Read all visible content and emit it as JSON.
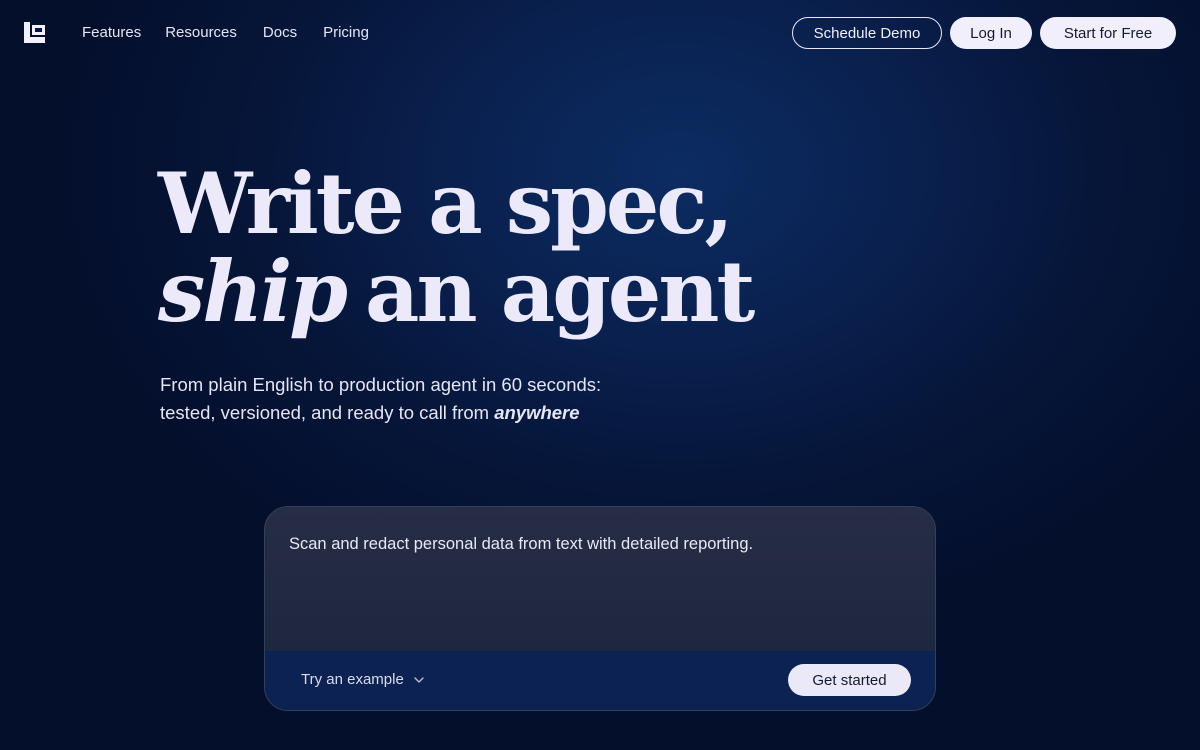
{
  "nav": {
    "links": [
      "Features",
      "Resources",
      "Docs",
      "Pricing"
    ],
    "schedule_demo": "Schedule Demo",
    "log_in": "Log In",
    "start_free": "Start for Free"
  },
  "hero": {
    "line1": "Write a spec,",
    "line2_emphasis": "ship",
    "line2_rest": "an agent",
    "subtitle_line1": "From plain English to production agent in 60 seconds:",
    "subtitle_line2": "tested, versioned, and ready to call from",
    "subtitle_emphasis": "anywhere"
  },
  "prompt": {
    "text": "Scan and redact personal data from text with detailed reporting.",
    "try_example": "Try an example",
    "get_started": "Get started"
  },
  "icons": {
    "logo": "brand-logo-icon",
    "chevron": "chevron-down-icon"
  },
  "colors": {
    "background": "#061538",
    "accent_button": "#f1effb",
    "card_bottom": "#0b2252"
  }
}
